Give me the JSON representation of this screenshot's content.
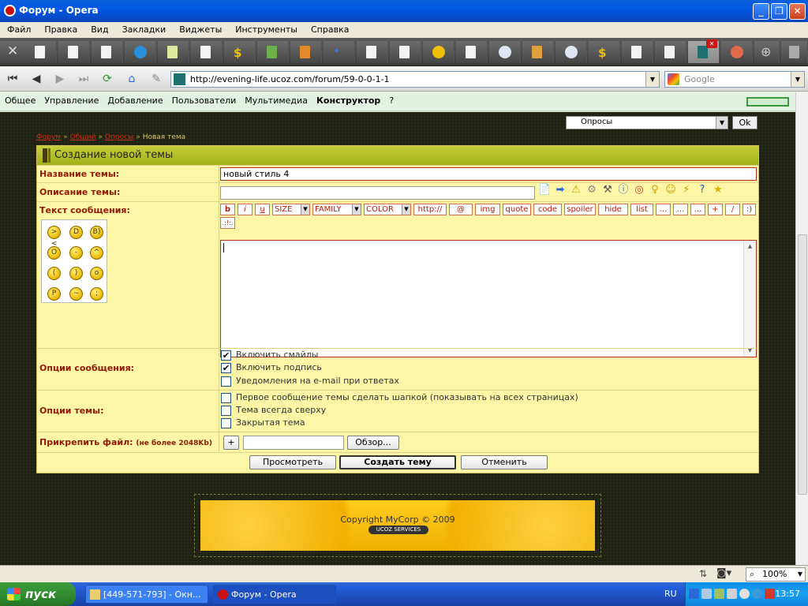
{
  "window": {
    "title": "Форум - Opera"
  },
  "menu": [
    "Файл",
    "Правка",
    "Вид",
    "Закладки",
    "Виджеты",
    "Инструменты",
    "Справка"
  ],
  "address": {
    "url": "http://evening-life.ucoz.com/forum/59-0-0-1-1",
    "search_placeholder": "Google"
  },
  "ucoz_bar": {
    "items": [
      "Общее",
      "Управление",
      "Добавление",
      "Пользователи",
      "Мультимедиа",
      "Конструктор",
      "?"
    ]
  },
  "forum_select": {
    "value": "Опросы",
    "ok_label": "Ok"
  },
  "breadcrumbs": {
    "root": "Форум",
    "sep": "»",
    "section": "Общий",
    "forum": "Опросы",
    "current": "Новая тема"
  },
  "form": {
    "header": "Создание новой темы",
    "title_label": "Название темы:",
    "title_value": "новый стиль 4",
    "desc_label": "Описание темы:",
    "text_label": "Текст сообщения:",
    "bbcode": {
      "b": "b",
      "i": "i",
      "u": "u",
      "size": "SIZE",
      "family": "FAMILY",
      "color": "COLOR",
      "http": "http://",
      "at": "@",
      "img": "img",
      "quote": "quote",
      "code": "code",
      "spoiler": "spoiler",
      "hide": "hide",
      "list": "list",
      "more1": "…",
      "more2": "…",
      "more3": "…",
      "plus": "+",
      "slash": "/",
      "smiley": ":)",
      "translit": ".:!:."
    },
    "msg_options_label": "Опции сообщения:",
    "opt_smiles": "Включить смайлы",
    "opt_signature": "Включить подпись",
    "opt_email": "Уведомления на e-mail при ответах",
    "topic_options_label": "Опции темы:",
    "opt_header": "Первое сообщение темы сделать шапкой (показывать на всех страницах)",
    "opt_sticky": "Тема всегда сверху",
    "opt_closed": "Закрытая тема",
    "attach_label": "Прикрепить файл:",
    "attach_limit": "(не более 2048Kb)",
    "attach_plus": "+",
    "browse_label": "Обзор...",
    "preview_label": "Просмотреть",
    "create_label": "Создать тему",
    "cancel_label": "Отменить"
  },
  "footer": {
    "copyright": "Copyright MyCorp © 2009",
    "badge": "UCOZ SERVICES"
  },
  "status": {
    "zoom": "100%"
  },
  "taskbar": {
    "start": "пуск",
    "task1": "[449-571-793] - Окн...",
    "task2": "Форум - Opera",
    "lang": "RU",
    "clock": "13:57"
  }
}
